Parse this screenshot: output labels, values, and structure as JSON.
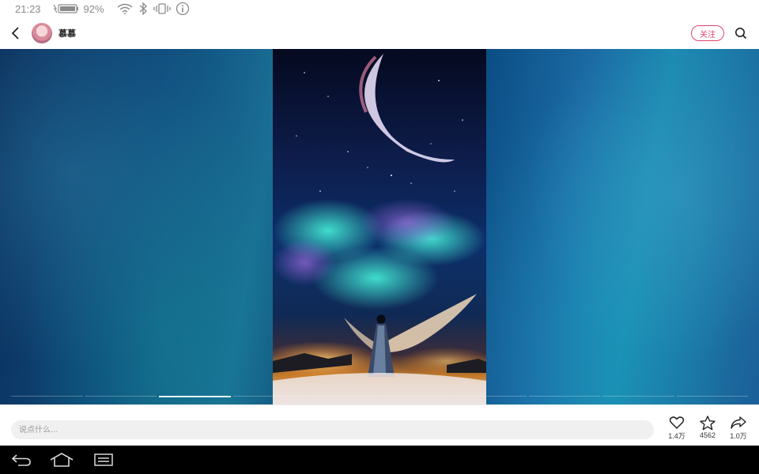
{
  "status_bar": {
    "time": "21:23",
    "battery": "92%"
  },
  "header": {
    "username": "慕慕",
    "follow_label": "关注"
  },
  "gallery": {
    "page_count": 10,
    "active_index": 2
  },
  "bottom": {
    "comment_placeholder": "说点什么...",
    "likes": "1.4万",
    "favorites": "4562",
    "shares": "1.0万"
  },
  "colors": {
    "accent": "#e0466b"
  }
}
